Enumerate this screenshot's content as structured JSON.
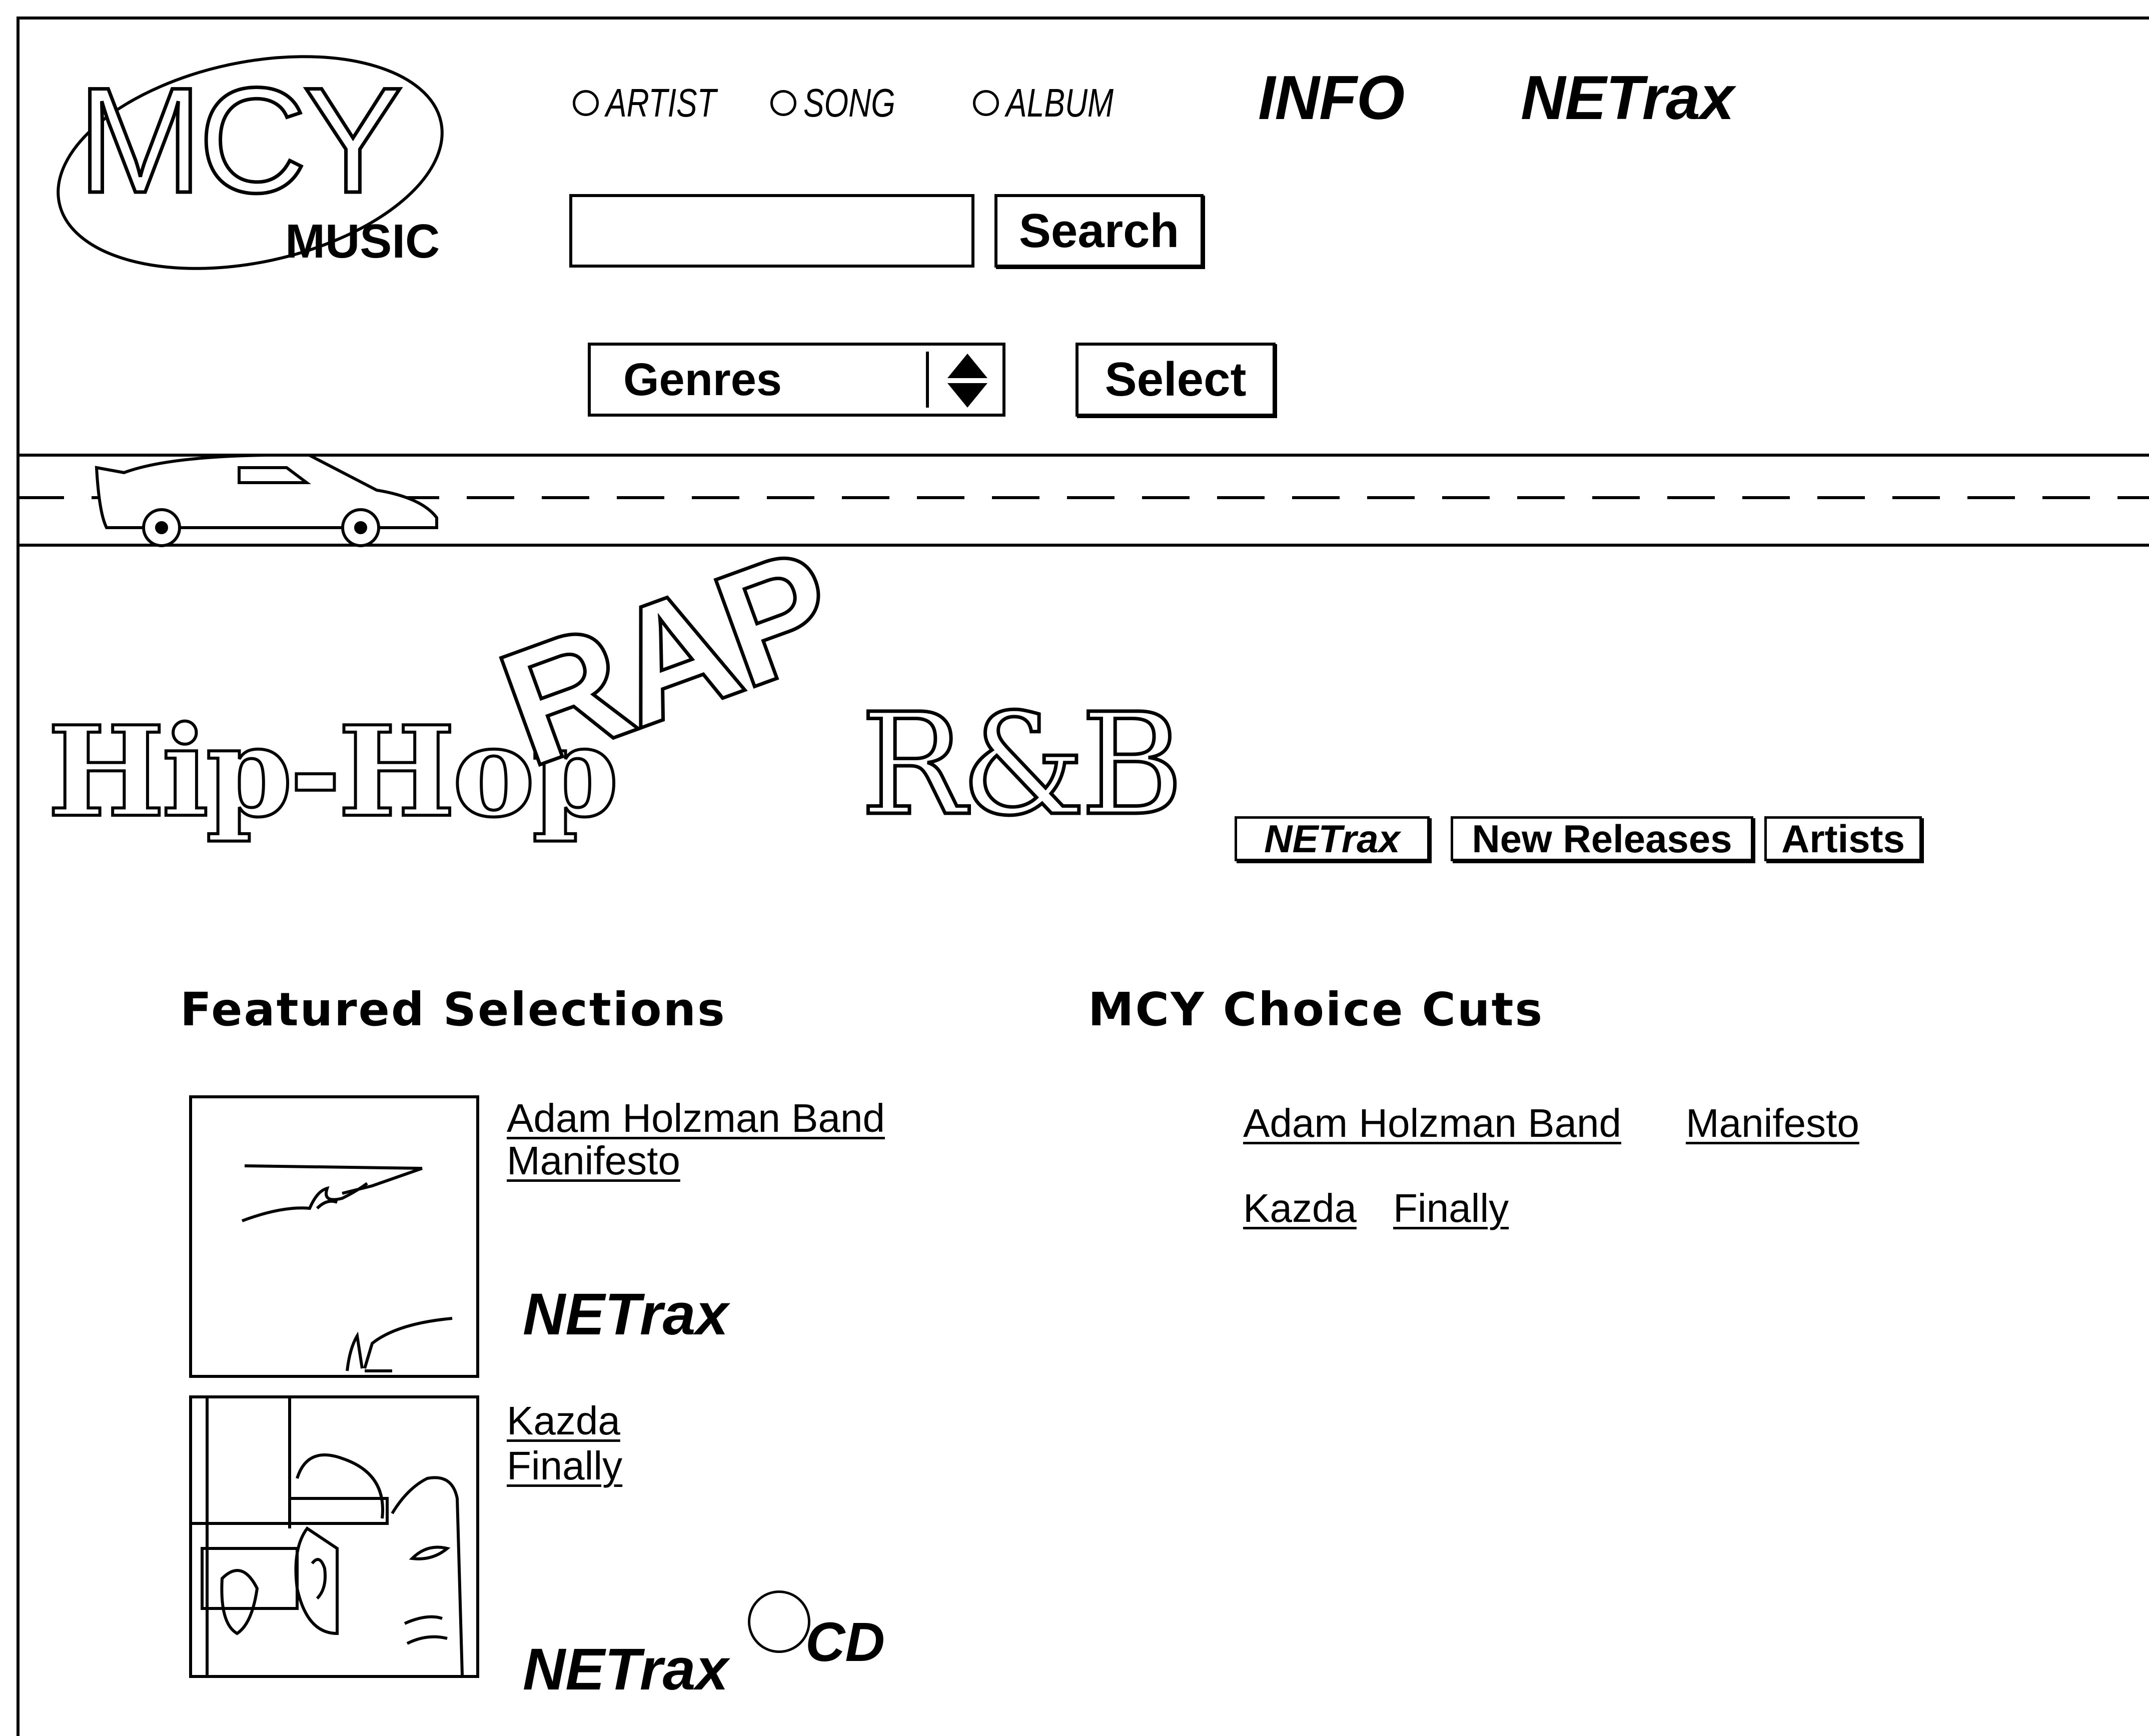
{
  "logo": {
    "letters": "MCY",
    "sub": "MUSIC"
  },
  "search_types": [
    "ARTIST",
    "SONG",
    "ALBUM"
  ],
  "nav": {
    "info": "INFO",
    "netrax": "NETrax"
  },
  "search": {
    "value": "",
    "button": "Search"
  },
  "genres": {
    "selected": "Genres",
    "button": "Select"
  },
  "banner": {
    "title_parts": [
      "Hip-Hop",
      "RAP",
      "R&B"
    ],
    "tabs": [
      "NETrax",
      "New Releases",
      "Artists"
    ]
  },
  "featured": {
    "heading": "Featured Selections",
    "items": [
      {
        "artist": "Adam Holzman Band",
        "album": "Manifesto",
        "badge": "NETrax"
      },
      {
        "artist": "Kazda",
        "album": "Finally",
        "badge": "NETrax",
        "cd_label": "CD"
      }
    ]
  },
  "choice": {
    "heading": "MCY Choice Cuts",
    "items": [
      {
        "artist": "Adam Holzman Band",
        "album": "Manifesto"
      },
      {
        "artist": "Kazda",
        "album": "Finally"
      }
    ]
  }
}
